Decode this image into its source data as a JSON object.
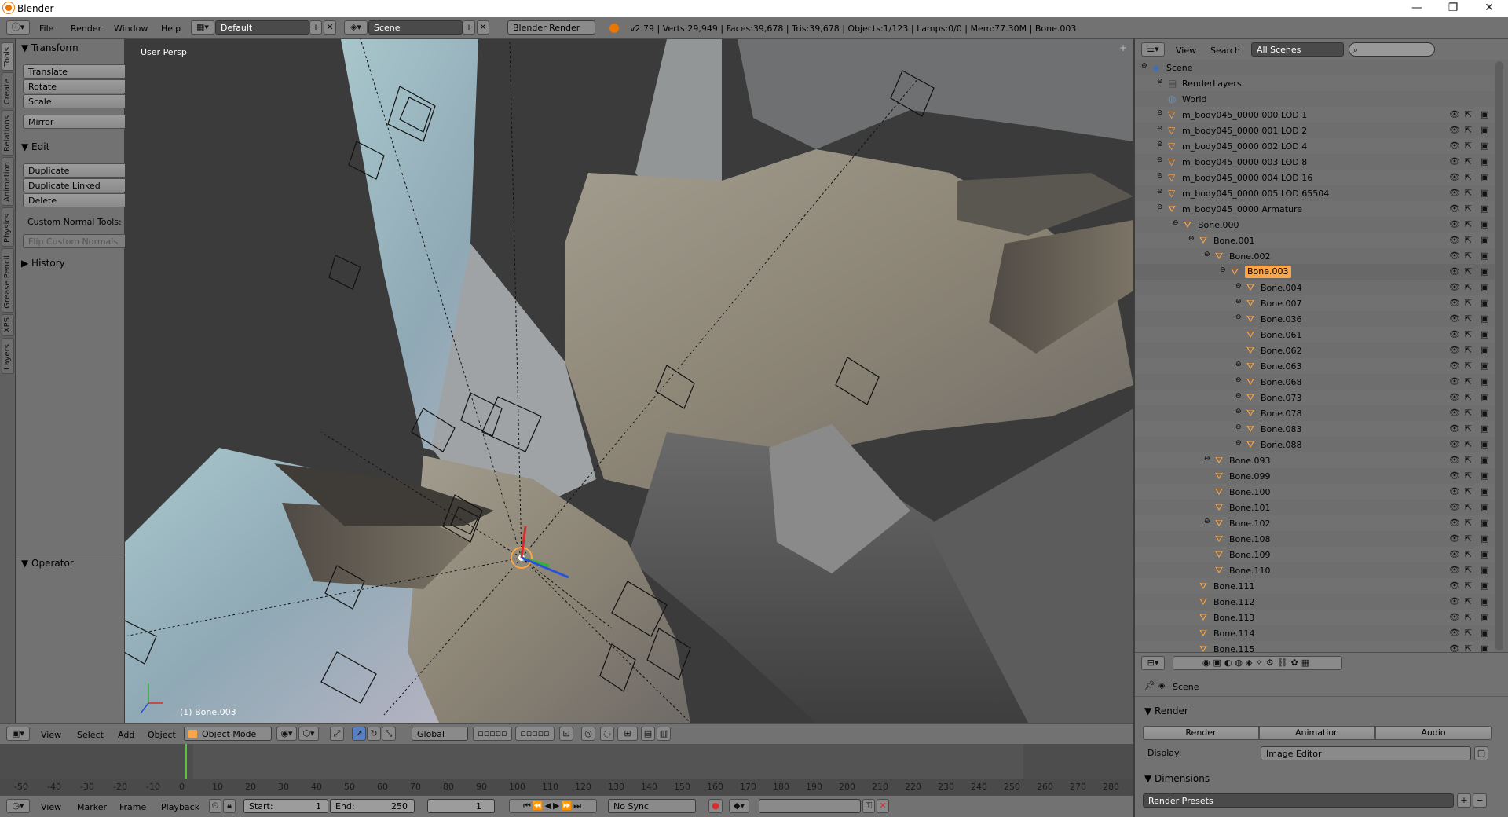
{
  "window": {
    "title": "Blender",
    "minimize": "—",
    "maximize": "❐",
    "close": "✕"
  },
  "info_header": {
    "menus": [
      "File",
      "Render",
      "Window",
      "Help"
    ],
    "layout": "Default",
    "scene": "Scene",
    "engine": "Blender Render",
    "stats": "v2.79 | Verts:29,949 | Faces:39,678 | Tris:39,678 | Objects:1/123 | Lamps:0/0 | Mem:77.30M | Bone.003"
  },
  "toolshelf": {
    "tabs": [
      "Tools",
      "Create",
      "Relations",
      "Animation",
      "Physics",
      "Grease Pencil",
      "XPS",
      "Layers"
    ],
    "transform": {
      "title": "Transform",
      "buttons": [
        "Translate",
        "Rotate",
        "Scale"
      ],
      "mirror": "Mirror"
    },
    "edit": {
      "title": "Edit",
      "buttons": [
        "Duplicate",
        "Duplicate Linked",
        "Delete"
      ],
      "custom_normal": "Custom Normal Tools:",
      "flip": "Flip Custom Normals"
    },
    "history": "History",
    "operator": "Operator"
  },
  "viewport": {
    "view_label": "User Persp",
    "object_label": "(1) Bone.003"
  },
  "view3d_header": {
    "menus": [
      "View",
      "Select",
      "Add",
      "Object"
    ],
    "mode": "Object Mode",
    "orientation": "Global"
  },
  "timeline": {
    "ticks": [
      "-50",
      "-40",
      "-30",
      "-20",
      "-10",
      "0",
      "10",
      "20",
      "30",
      "40",
      "50",
      "60",
      "70",
      "80",
      "90",
      "100",
      "110",
      "120",
      "130",
      "140",
      "150",
      "160",
      "170",
      "180",
      "190",
      "200",
      "210",
      "220",
      "230",
      "240",
      "250",
      "260",
      "270",
      "280"
    ],
    "current_frame_tick": "0"
  },
  "timeline_header": {
    "menus": [
      "View",
      "Marker",
      "Frame",
      "Playback"
    ],
    "start_label": "Start:",
    "start": "1",
    "end_label": "End:",
    "end": "250",
    "current": "1",
    "sync": "No Sync"
  },
  "outliner_header": {
    "menus": [
      "View",
      "Search"
    ],
    "filter": "All Scenes"
  },
  "outliner": {
    "rows": [
      {
        "name": "Scene",
        "indent": 0,
        "icon": "scene"
      },
      {
        "name": "RenderLayers",
        "indent": 1,
        "icon": "renderlayers"
      },
      {
        "name": "World",
        "indent": 1,
        "icon": "world"
      },
      {
        "name": "m_body045_0000 000 LOD 1",
        "indent": 1,
        "icon": "mesh"
      },
      {
        "name": "m_body045_0000 001 LOD 2",
        "indent": 1,
        "icon": "mesh"
      },
      {
        "name": "m_body045_0000 002 LOD 4",
        "indent": 1,
        "icon": "mesh"
      },
      {
        "name": "m_body045_0000 003 LOD 8",
        "indent": 1,
        "icon": "mesh"
      },
      {
        "name": "m_body045_0000 004 LOD 16",
        "indent": 1,
        "icon": "mesh"
      },
      {
        "name": "m_body045_0000 005 LOD 65504",
        "indent": 1,
        "icon": "mesh"
      },
      {
        "name": "m_body045_0000 Armature",
        "indent": 1,
        "icon": "armature"
      },
      {
        "name": "Bone.000",
        "indent": 2,
        "icon": "bone"
      },
      {
        "name": "Bone.001",
        "indent": 3,
        "icon": "bone"
      },
      {
        "name": "Bone.002",
        "indent": 4,
        "icon": "bone"
      },
      {
        "name": "Bone.003",
        "indent": 5,
        "icon": "bone",
        "selected": true
      },
      {
        "name": "Bone.004",
        "indent": 6,
        "icon": "bone"
      },
      {
        "name": "Bone.007",
        "indent": 6,
        "icon": "bone"
      },
      {
        "name": "Bone.036",
        "indent": 6,
        "icon": "bone"
      },
      {
        "name": "Bone.061",
        "indent": 6,
        "icon": "bone"
      },
      {
        "name": "Bone.062",
        "indent": 6,
        "icon": "bone"
      },
      {
        "name": "Bone.063",
        "indent": 6,
        "icon": "bone"
      },
      {
        "name": "Bone.068",
        "indent": 6,
        "icon": "bone"
      },
      {
        "name": "Bone.073",
        "indent": 6,
        "icon": "bone"
      },
      {
        "name": "Bone.078",
        "indent": 6,
        "icon": "bone"
      },
      {
        "name": "Bone.083",
        "indent": 6,
        "icon": "bone"
      },
      {
        "name": "Bone.088",
        "indent": 6,
        "icon": "bone"
      },
      {
        "name": "Bone.093",
        "indent": 4,
        "icon": "bone"
      },
      {
        "name": "Bone.099",
        "indent": 4,
        "icon": "bone"
      },
      {
        "name": "Bone.100",
        "indent": 4,
        "icon": "bone"
      },
      {
        "name": "Bone.101",
        "indent": 4,
        "icon": "bone"
      },
      {
        "name": "Bone.102",
        "indent": 4,
        "icon": "bone"
      },
      {
        "name": "Bone.108",
        "indent": 4,
        "icon": "bone"
      },
      {
        "name": "Bone.109",
        "indent": 4,
        "icon": "bone"
      },
      {
        "name": "Bone.110",
        "indent": 4,
        "icon": "bone"
      },
      {
        "name": "Bone.111",
        "indent": 3,
        "icon": "bone"
      },
      {
        "name": "Bone.112",
        "indent": 3,
        "icon": "bone"
      },
      {
        "name": "Bone.113",
        "indent": 3,
        "icon": "bone"
      },
      {
        "name": "Bone.114",
        "indent": 3,
        "icon": "bone"
      },
      {
        "name": "Bone.115",
        "indent": 3,
        "icon": "bone"
      }
    ]
  },
  "properties": {
    "context": "Scene",
    "render_panel": "Render",
    "buttons": [
      "Render",
      "Animation",
      "Audio"
    ],
    "display_label": "Display:",
    "display_value": "Image Editor",
    "dimensions_panel": "Dimensions",
    "presets": "Render Presets"
  },
  "colors": {
    "accent": "#f9a64a",
    "header": "#727272",
    "panel": "#727272",
    "field": "#4a4a4a",
    "frame_marker": "#5ac43c"
  }
}
